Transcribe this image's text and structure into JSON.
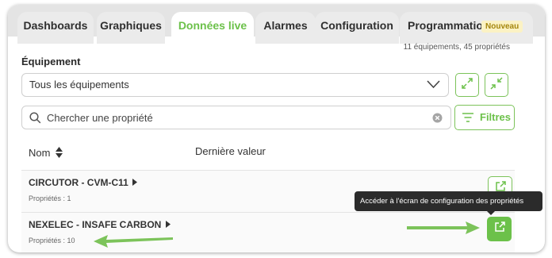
{
  "tabs": [
    {
      "label": "Dashboards",
      "active": false
    },
    {
      "label": "Graphiques",
      "active": false
    },
    {
      "label": "Données live",
      "active": true
    },
    {
      "label": "Alarmes",
      "active": false
    },
    {
      "label": "Configuration",
      "active": false
    },
    {
      "label": "Programmation",
      "active": false
    }
  ],
  "new_badge": "Nouveau",
  "summary": "11 équipements, 45 propriétés",
  "equipment": {
    "label": "Équipement",
    "selected": "Tous les équipements"
  },
  "search": {
    "placeholder": "Chercher une propriété"
  },
  "filters_label": "Filtres",
  "table": {
    "col_name": "Nom",
    "col_last_value": "Dernière valeur",
    "rows": [
      {
        "name": "CIRCUTOR - CVM-C11",
        "props": "Propriétés : 1"
      },
      {
        "name": "NEXELEC - INSAFE CARBON",
        "props": "Propriétés : 10"
      }
    ]
  },
  "tooltip": "Accéder à l'écran de configuration des propriétés",
  "colors": {
    "accent": "#6cc14a",
    "arrow": "#7cc35a",
    "badge_bg": "#fbf2c4",
    "tooltip_bg": "#2b2b2b"
  }
}
